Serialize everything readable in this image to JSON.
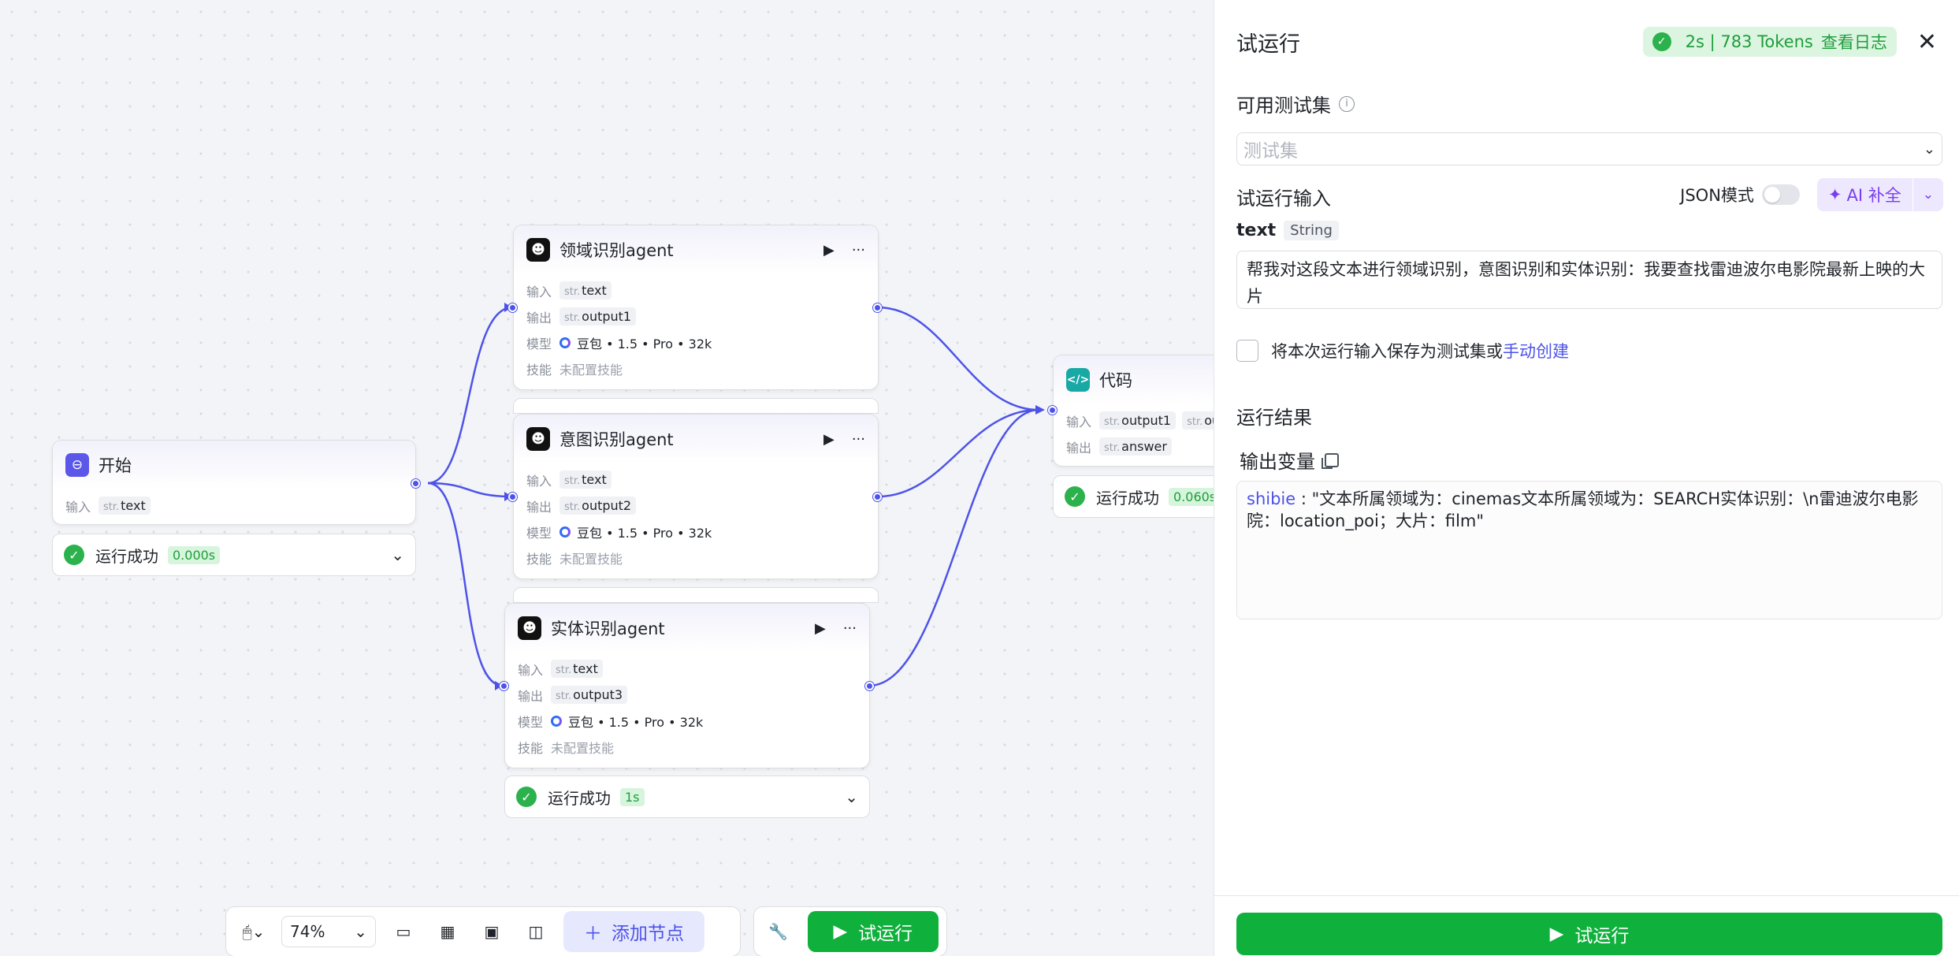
{
  "canvas": {
    "start_node": {
      "title": "开始",
      "input_label": "输入",
      "input_type": "str.",
      "input_var": "text",
      "status": "运行成功",
      "time": "0.000s"
    },
    "agents": [
      {
        "title": "领域识别agent",
        "input_label": "输入",
        "input_type": "str.",
        "input_var": "text",
        "output_label": "输出",
        "output_type": "str.",
        "output_var": "output1",
        "model_label": "模型",
        "model": "豆包 • 1.5 • Pro • 32k",
        "skill_label": "技能",
        "skill": "未配置技能"
      },
      {
        "title": "意图识别agent",
        "input_label": "输入",
        "input_type": "str.",
        "input_var": "text",
        "output_label": "输出",
        "output_type": "str.",
        "output_var": "output2",
        "model_label": "模型",
        "model": "豆包 • 1.5 • Pro • 32k",
        "skill_label": "技能",
        "skill": "未配置技能"
      },
      {
        "title": "实体识别agent",
        "input_label": "输入",
        "input_type": "str.",
        "input_var": "text",
        "output_label": "输出",
        "output_type": "str.",
        "output_var": "output3",
        "model_label": "模型",
        "model": "豆包 • 1.5 • Pro • 32k",
        "skill_label": "技能",
        "skill": "未配置技能",
        "status": "运行成功",
        "time": "1s"
      }
    ],
    "code_node": {
      "title": "代码",
      "input_label": "输入",
      "input_type": "str.",
      "input_var1": "output1",
      "input_var2": "out",
      "output_label": "输出",
      "output_type": "str.",
      "output_var": "answer",
      "status": "运行成功",
      "time": "0.060s"
    }
  },
  "toolbar": {
    "zoom": "74%",
    "add_node": "添加节点",
    "run": "试运行"
  },
  "panel": {
    "title": "试运行",
    "tokens": "2s | 783 Tokens",
    "view_log": "查看日志",
    "testset_label": "可用测试集",
    "testset_placeholder": "测试集",
    "input_label": "试运行输入",
    "json_mode": "JSON模式",
    "ai_fill": "AI 补全",
    "var_name": "text",
    "var_type": "String",
    "input_value": "帮我对这段文本进行领域识别，意图识别和实体识别：我要查找雷迪波尔电影院最新上映的大片",
    "save_text": "将本次运行输入保存为测试集或",
    "manual_create": "手动创建",
    "result_label": "运行结果",
    "output_var_label": "输出变量",
    "result_key": "shibie",
    "result_value": "\"文本所属领域为：cinemas文本所属领域为：SEARCH实体识别：\\n雷迪波尔电影院：location_poi；大片：film\"",
    "run_button": "试运行"
  }
}
